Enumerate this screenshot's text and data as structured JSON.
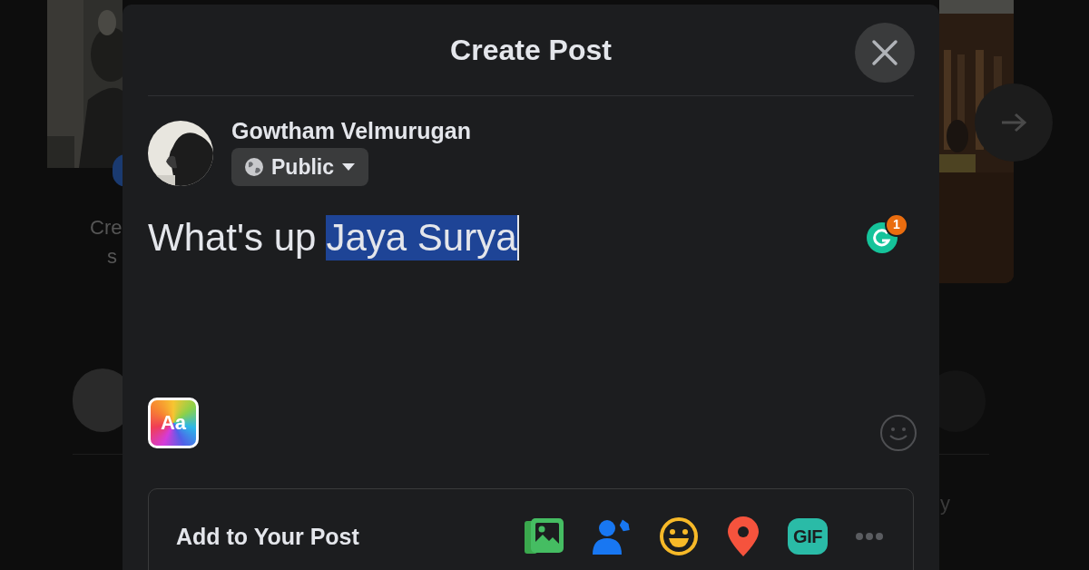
{
  "background": {
    "texts": [
      "Cre",
      "s",
      "y"
    ]
  },
  "dialog": {
    "title": "Create Post",
    "author": {
      "name": "Gowtham Velmurugan",
      "audience": "Public"
    },
    "composer": {
      "segments": [
        {
          "text": "What's up",
          "selected": false
        },
        {
          "text": "Jaya Surya",
          "selected": true
        }
      ]
    },
    "grammar_badge": "1",
    "text_style_label": "Aa",
    "add_to_post": {
      "label": "Add to Your Post",
      "gif_label": "GIF"
    }
  }
}
